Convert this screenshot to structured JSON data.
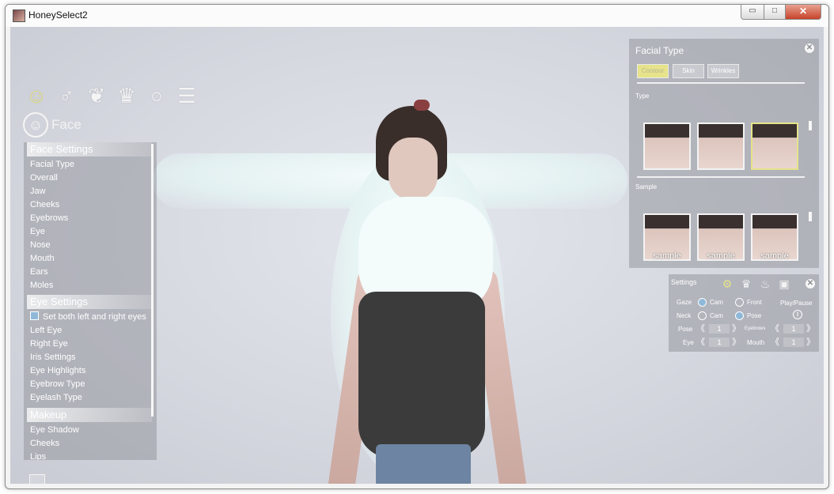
{
  "window": {
    "title": "HoneySelect2",
    "min_glyph": "▭",
    "max_glyph": "□",
    "close_glyph": "✕"
  },
  "toolbar": {
    "tools": [
      {
        "icon": "face-icon",
        "glyph": "☺"
      },
      {
        "icon": "body-icon",
        "glyph": "♂"
      },
      {
        "icon": "hair-icon",
        "glyph": "❦"
      },
      {
        "icon": "clothes-icon",
        "glyph": "♛"
      },
      {
        "icon": "accessory-icon",
        "glyph": "○"
      },
      {
        "icon": "list-icon",
        "glyph": "☰"
      }
    ]
  },
  "section_header": {
    "glyph": "☺",
    "label": "Face"
  },
  "menu": {
    "face_settings": "Face Settings",
    "face_items": [
      "Facial Type",
      "Overall",
      "Jaw",
      "Cheeks",
      "Eyebrows",
      "Eye",
      "Nose",
      "Mouth",
      "Ears",
      "Moles"
    ],
    "eye_settings": "Eye Settings",
    "eye_checkbox": "Set both left and right eyes",
    "eye_items": [
      "Left Eye",
      "Right Eye",
      "Iris Settings",
      "Eye Highlights",
      "Eyebrow Type",
      "Eyelash Type"
    ],
    "makeup": "Makeup",
    "makeup_items": [
      "Eye Shadow",
      "Cheeks",
      "Lips"
    ]
  },
  "facial_type": {
    "title": "Facial Type",
    "close_glyph": "✕",
    "tabs": [
      "Contour",
      "Skin",
      "Wrinkles"
    ],
    "type_label": "Type",
    "sample_label": "Sample",
    "sample_caption": "sample"
  },
  "settings": {
    "title": "Settings",
    "gear_glyph": "⚙",
    "outfit_glyph": "♛",
    "bottle_glyph": "♨",
    "image_glyph": "▣",
    "close_glyph": "✕",
    "gaze": "Gaze",
    "neck": "Neck",
    "cam": "Cam",
    "front": "Front",
    "pose_opt": "Pose",
    "play_pause": "Play/Pause",
    "play_glyph": "||",
    "pose": "Pose",
    "eyebrows": "Eyebrows",
    "eye": "Eye",
    "mouth": "Mouth",
    "pose_value": "1",
    "eyebrows_value": "1",
    "eye_value": "1",
    "mouth_value": "1",
    "left_glyph": "《",
    "right_glyph": "》"
  }
}
